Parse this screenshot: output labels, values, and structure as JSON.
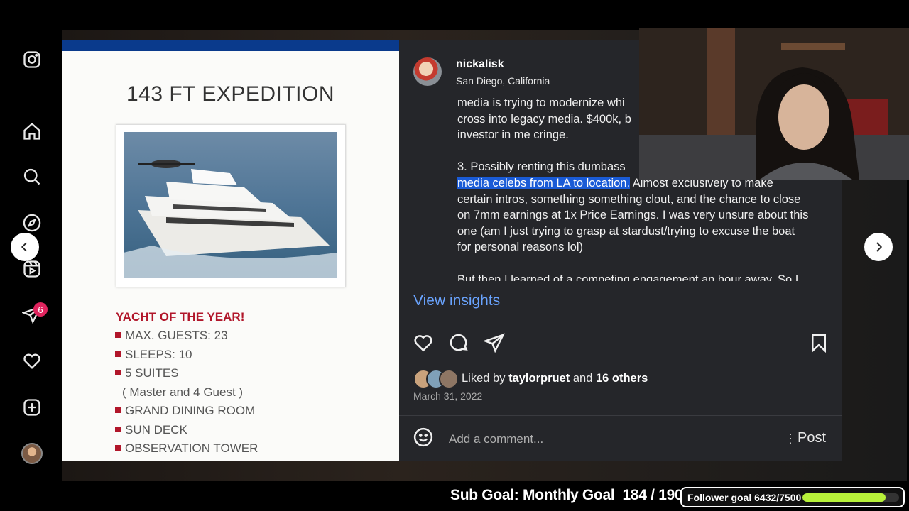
{
  "post": {
    "username": "nickalisk",
    "location": "San Diego, California",
    "caption_lines": [
      "media is trying to modernize whi",
      "cross into legacy media. $400k, b",
      "investor in me cringe.",
      "",
      "3. Possibly renting this dumbass"
    ],
    "caption_highlight": "media celebs from LA to location.",
    "caption_after_highlight": " Almost exclusively to make",
    "caption_rest": [
      "certain intros, something something clout, and the chance to close",
      "on 7mm earnings at 1x Price Earnings. I was very unsure about this",
      "one (am I just trying to grasp at stardust/trying to excuse the boat",
      "for personal reasons lol)",
      "",
      "But then I learned of a competing engagement an hour away. So I"
    ],
    "view_insights": "View insights",
    "liked_prefix": "Liked by",
    "liked_user": "taylorpruet",
    "liked_and": "and",
    "liked_others": "16 others",
    "date": "March 31, 2022",
    "comment_placeholder": "Add a comment...",
    "post_button": "Post"
  },
  "image": {
    "title": "143 FT EXPEDITION",
    "heading": "YACHT OF THE YEAR!",
    "specs": [
      {
        "text": "MAX. GUESTS: 23",
        "bullet": true
      },
      {
        "text": "SLEEPS: 10",
        "bullet": true
      },
      {
        "text": "5 SUITES",
        "bullet": true
      },
      {
        "text": "( Master and 4 Guest )",
        "bullet": false
      },
      {
        "text": "GRAND DINING ROOM",
        "bullet": true
      },
      {
        "text": "SUN DECK",
        "bullet": true
      },
      {
        "text": "OBSERVATION TOWER",
        "bullet": true
      }
    ]
  },
  "nav": {
    "items": [
      "instagram-icon",
      "home-icon",
      "search-icon",
      "explore-icon",
      "reels-icon",
      "messages-icon",
      "notifications-icon",
      "create-icon",
      "profile-avatar"
    ],
    "messages_badge": "6"
  },
  "stream": {
    "sub_goal_label": "Sub Goal: Monthly Goal",
    "sub_goal_value": "184 / 190",
    "follower_goal": "Follower goal 6432/7500",
    "follower_progress": 0.8576
  },
  "colors": {
    "panel": "#25262a",
    "link": "#6aa4ff",
    "highlight": "#1a5bd6",
    "yacht_red": "#b1162a",
    "progress": "#b8f23a"
  }
}
